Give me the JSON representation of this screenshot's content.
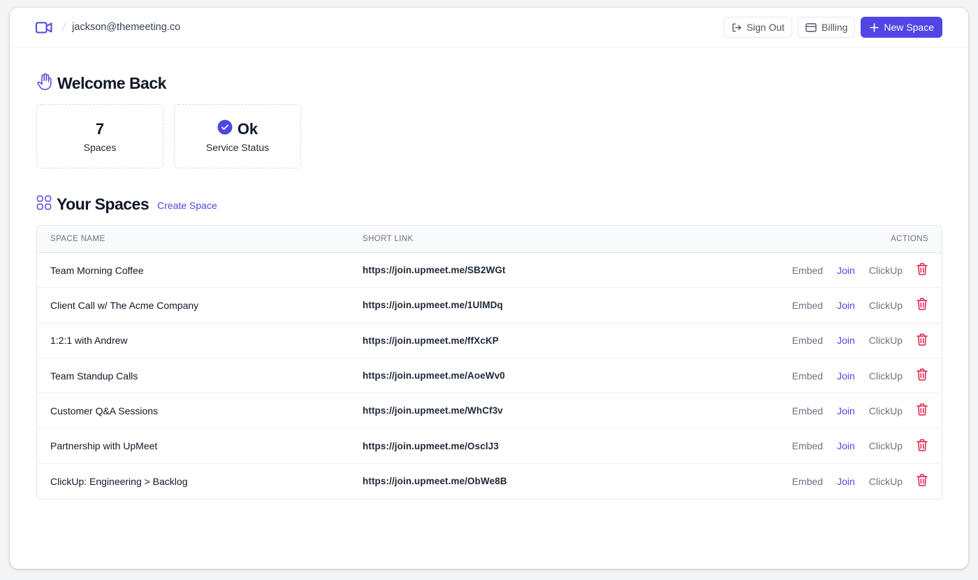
{
  "header": {
    "email": "jackson@themeeting.co",
    "separator": "/",
    "sign_out_label": "Sign Out",
    "billing_label": "Billing",
    "new_space_label": "New Space"
  },
  "welcome": {
    "title": "Welcome Back",
    "stats": [
      {
        "value": "7",
        "label": "Spaces"
      },
      {
        "value": "Ok",
        "label": "Service Status"
      }
    ]
  },
  "spaces": {
    "title": "Your Spaces",
    "create_link": "Create Space",
    "columns": {
      "name": "SPACE NAME",
      "link": "SHORT LINK",
      "actions": "ACTIONS"
    },
    "actions": {
      "embed": "Embed",
      "join": "Join",
      "clickup": "ClickUp"
    },
    "rows": [
      {
        "name": "Team Morning Coffee",
        "link": "https://join.upmeet.me/SB2WGt"
      },
      {
        "name": "Client Call w/ The Acme Company",
        "link": "https://join.upmeet.me/1UlMDq"
      },
      {
        "name": "1:2:1 with Andrew",
        "link": "https://join.upmeet.me/ffXcKP"
      },
      {
        "name": "Team Standup Calls",
        "link": "https://join.upmeet.me/AoeWv0"
      },
      {
        "name": "Customer Q&A Sessions",
        "link": "https://join.upmeet.me/WhCf3v"
      },
      {
        "name": "Partnership with UpMeet",
        "link": "https://join.upmeet.me/OsclJ3"
      },
      {
        "name": "ClickUp: Engineering > Backlog",
        "link": "https://join.upmeet.me/ObWe8B"
      }
    ]
  },
  "colors": {
    "accent": "#4f46e5",
    "delete": "#e11d48",
    "muted": "#6b7280"
  },
  "icons": {
    "logo": "video-camera-icon",
    "sign_out": "logout-icon",
    "billing": "credit-card-icon",
    "new_space": "plus-icon",
    "welcome": "hand-wave-icon",
    "status": "check-circle-icon",
    "spaces": "grid-icon",
    "delete": "trash-icon"
  }
}
